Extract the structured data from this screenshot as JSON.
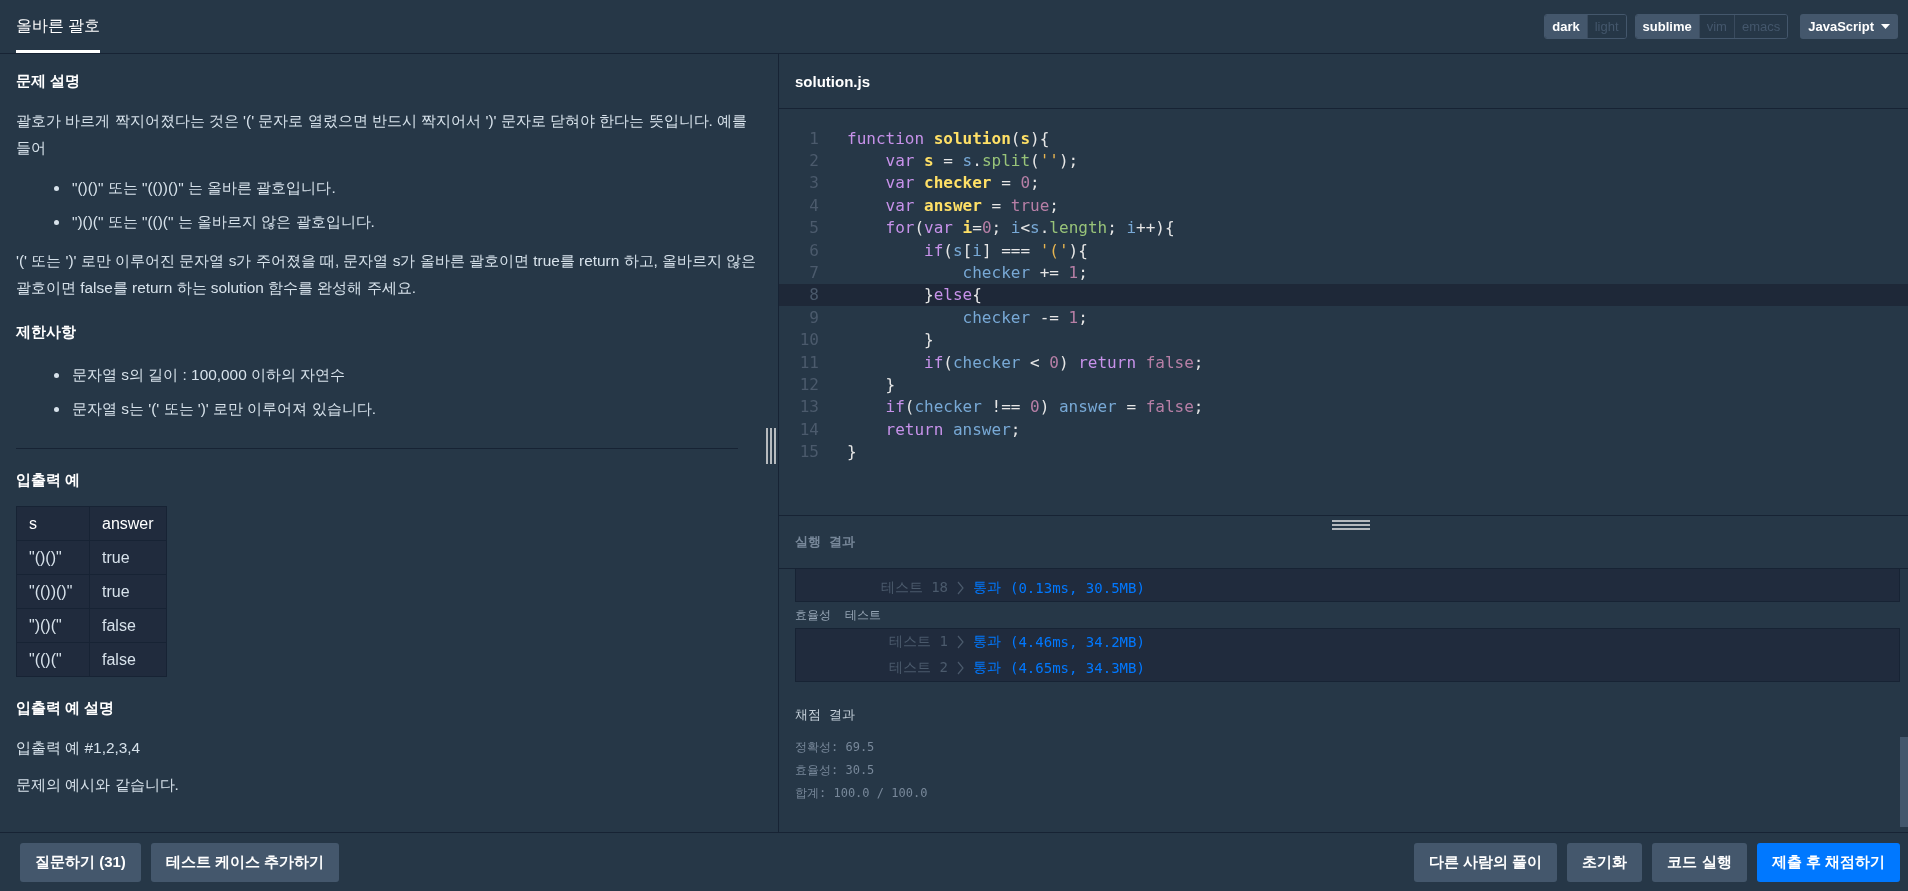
{
  "tabs": [
    {
      "label": "올바른 괄호",
      "selected": true
    }
  ],
  "theme_toggle": [
    {
      "label": "dark",
      "selected": true
    },
    {
      "label": "light",
      "selected": false
    }
  ],
  "keymap_toggle": [
    {
      "label": "sublime",
      "selected": true
    },
    {
      "label": "vim",
      "selected": false
    },
    {
      "label": "emacs",
      "selected": false
    }
  ],
  "language_dropdown": {
    "value": "JavaScript"
  },
  "problem": {
    "sections": [
      {
        "kind": "text",
        "heading": "문제 설명",
        "paragraphs": [
          "괄호가 바르게 짝지어졌다는 것은 '(' 문자로 열렸으면 반드시 짝지어서 ')' 문자로 닫혀야 한다는 뜻입니다. 예를 들어"
        ],
        "bullets": [
          "\"()()\" 또는 \"(())()\" 는 올바른 괄호입니다.",
          "\")()(\" 또는 \"(()(\" 는 올바르지 않은 괄호입니다."
        ],
        "after": [
          "'(' 또는 ')' 로만 이루어진 문자열 s가 주어졌을 때, 문자열 s가 올바른 괄호이면 true를 return 하고, 올바르지 않은 괄호이면 false를 return 하는 solution 함수를 완성해 주세요."
        ]
      },
      {
        "kind": "text",
        "heading": "제한사항",
        "bullets": [
          "문자열 s의 길이 : 100,000 이하의 자연수",
          "문자열 s는 '(' 또는 ')' 로만 이루어져 있습니다."
        ]
      },
      {
        "kind": "divider"
      },
      {
        "kind": "table",
        "heading": "입출력 예",
        "columns": [
          "s",
          "answer"
        ],
        "rows": [
          [
            "\"()()\"",
            "true"
          ],
          [
            "\"(())()\"",
            "true"
          ],
          [
            "\")()(\"",
            "false"
          ],
          [
            "\"(()(\"",
            "false"
          ]
        ]
      },
      {
        "kind": "text",
        "heading": "입출력 예 설명",
        "paragraphs": [
          "입출력 예 #1,2,3,4",
          "문제의 예시와 같습니다."
        ]
      }
    ]
  },
  "editor": {
    "filename": "solution.js",
    "lines": [
      {
        "number": "1",
        "highlighted": false,
        "tokens": [
          {
            "kind": "keyword",
            "text": "function "
          },
          {
            "kind": "name",
            "text": "solution"
          },
          {
            "kind": "plain",
            "text": "("
          },
          {
            "kind": "name",
            "text": "s"
          },
          {
            "kind": "plain",
            "text": "){"
          }
        ]
      },
      {
        "number": "2",
        "highlighted": false,
        "tokens": [
          {
            "kind": "keyword",
            "text": "    var "
          },
          {
            "kind": "name",
            "text": "s"
          },
          {
            "kind": "plain",
            "text": " = "
          },
          {
            "kind": "ident",
            "text": "s"
          },
          {
            "kind": "plain",
            "text": "."
          },
          {
            "kind": "method",
            "text": "split"
          },
          {
            "kind": "plain",
            "text": "("
          },
          {
            "kind": "string",
            "text": "''"
          },
          {
            "kind": "plain",
            "text": ");"
          }
        ]
      },
      {
        "number": "3",
        "highlighted": false,
        "tokens": [
          {
            "kind": "keyword",
            "text": "    var "
          },
          {
            "kind": "name",
            "text": "checker"
          },
          {
            "kind": "plain",
            "text": " = "
          },
          {
            "kind": "literal",
            "text": "0"
          },
          {
            "kind": "plain",
            "text": ";"
          }
        ]
      },
      {
        "number": "4",
        "highlighted": false,
        "tokens": [
          {
            "kind": "keyword",
            "text": "    var "
          },
          {
            "kind": "name",
            "text": "answer"
          },
          {
            "kind": "plain",
            "text": " = "
          },
          {
            "kind": "literal",
            "text": "true"
          },
          {
            "kind": "plain",
            "text": ";"
          }
        ]
      },
      {
        "number": "5",
        "highlighted": false,
        "tokens": [
          {
            "kind": "keyword",
            "text": "    for"
          },
          {
            "kind": "plain",
            "text": "("
          },
          {
            "kind": "keyword",
            "text": "var "
          },
          {
            "kind": "name",
            "text": "i"
          },
          {
            "kind": "plain",
            "text": "="
          },
          {
            "kind": "literal",
            "text": "0"
          },
          {
            "kind": "plain",
            "text": "; "
          },
          {
            "kind": "ident",
            "text": "i"
          },
          {
            "kind": "plain",
            "text": "<"
          },
          {
            "kind": "ident",
            "text": "s"
          },
          {
            "kind": "plain",
            "text": "."
          },
          {
            "kind": "method",
            "text": "length"
          },
          {
            "kind": "plain",
            "text": "; "
          },
          {
            "kind": "ident",
            "text": "i"
          },
          {
            "kind": "plain",
            "text": "++){"
          }
        ]
      },
      {
        "number": "6",
        "highlighted": false,
        "tokens": [
          {
            "kind": "keyword",
            "text": "        if"
          },
          {
            "kind": "plain",
            "text": "("
          },
          {
            "kind": "ident",
            "text": "s"
          },
          {
            "kind": "plain",
            "text": "["
          },
          {
            "kind": "ident",
            "text": "i"
          },
          {
            "kind": "plain",
            "text": "] === "
          },
          {
            "kind": "string",
            "text": "'('"
          },
          {
            "kind": "plain",
            "text": "){"
          }
        ]
      },
      {
        "number": "7",
        "highlighted": false,
        "tokens": [
          {
            "kind": "ident",
            "text": "            checker"
          },
          {
            "kind": "plain",
            "text": " += "
          },
          {
            "kind": "literal",
            "text": "1"
          },
          {
            "kind": "plain",
            "text": ";"
          }
        ]
      },
      {
        "number": "8",
        "highlighted": true,
        "tokens": [
          {
            "kind": "plain",
            "text": "        }"
          },
          {
            "kind": "keyword",
            "text": "else"
          },
          {
            "kind": "plain",
            "text": "{"
          }
        ]
      },
      {
        "number": "9",
        "highlighted": false,
        "tokens": [
          {
            "kind": "ident",
            "text": "            checker"
          },
          {
            "kind": "plain",
            "text": " -= "
          },
          {
            "kind": "literal",
            "text": "1"
          },
          {
            "kind": "plain",
            "text": ";"
          }
        ]
      },
      {
        "number": "10",
        "highlighted": false,
        "tokens": [
          {
            "kind": "plain",
            "text": "        }"
          }
        ]
      },
      {
        "number": "11",
        "highlighted": false,
        "tokens": [
          {
            "kind": "keyword",
            "text": "        if"
          },
          {
            "kind": "plain",
            "text": "("
          },
          {
            "kind": "ident",
            "text": "checker"
          },
          {
            "kind": "plain",
            "text": " < "
          },
          {
            "kind": "literal",
            "text": "0"
          },
          {
            "kind": "plain",
            "text": ") "
          },
          {
            "kind": "keyword",
            "text": "return "
          },
          {
            "kind": "literal",
            "text": "false"
          },
          {
            "kind": "plain",
            "text": ";"
          }
        ]
      },
      {
        "number": "12",
        "highlighted": false,
        "tokens": [
          {
            "kind": "plain",
            "text": "    }"
          }
        ]
      },
      {
        "number": "13",
        "highlighted": false,
        "tokens": [
          {
            "kind": "keyword",
            "text": "    if"
          },
          {
            "kind": "plain",
            "text": "("
          },
          {
            "kind": "ident",
            "text": "checker"
          },
          {
            "kind": "plain",
            "text": " !== "
          },
          {
            "kind": "literal",
            "text": "0"
          },
          {
            "kind": "plain",
            "text": ") "
          },
          {
            "kind": "ident",
            "text": "answer"
          },
          {
            "kind": "plain",
            "text": " = "
          },
          {
            "kind": "literal",
            "text": "false"
          },
          {
            "kind": "plain",
            "text": ";"
          }
        ]
      },
      {
        "number": "14",
        "highlighted": false,
        "tokens": [
          {
            "kind": "keyword",
            "text": "    return "
          },
          {
            "kind": "ident",
            "text": "answer"
          },
          {
            "kind": "plain",
            "text": ";"
          }
        ]
      },
      {
        "number": "15",
        "highlighted": false,
        "tokens": [
          {
            "kind": "plain",
            "text": "}"
          }
        ]
      }
    ]
  },
  "results": {
    "title": "실행 결과",
    "blocks": [
      {
        "kind": "tests",
        "tests": [
          {
            "name": "테스트 18",
            "status": "통과",
            "detail": "(0.13ms, 30.5MB)"
          }
        ]
      },
      {
        "kind": "label",
        "text": "효율성  테스트"
      },
      {
        "kind": "tests",
        "tests": [
          {
            "name": "테스트 1",
            "status": "통과",
            "detail": "(4.46ms, 34.2MB)"
          },
          {
            "name": "테스트 2",
            "status": "통과",
            "detail": "(4.65ms, 34.3MB)"
          }
        ]
      }
    ],
    "grading": {
      "title": "채점 결과",
      "lines": [
        "정확성: 69.5",
        "효율성: 30.5",
        "합계: 100.0 / 100.0"
      ]
    }
  },
  "footer": {
    "left_buttons": [
      {
        "label": "질문하기 (31)",
        "kind": "secondary"
      },
      {
        "label": "테스트 케이스 추가하기",
        "kind": "secondary"
      }
    ],
    "right_buttons": [
      {
        "label": "다른 사람의 풀이",
        "kind": "secondary"
      },
      {
        "label": "초기화",
        "kind": "secondary"
      },
      {
        "label": "코드 실행",
        "kind": "secondary"
      },
      {
        "label": "제출 후 채점하기",
        "kind": "primary"
      }
    ]
  }
}
